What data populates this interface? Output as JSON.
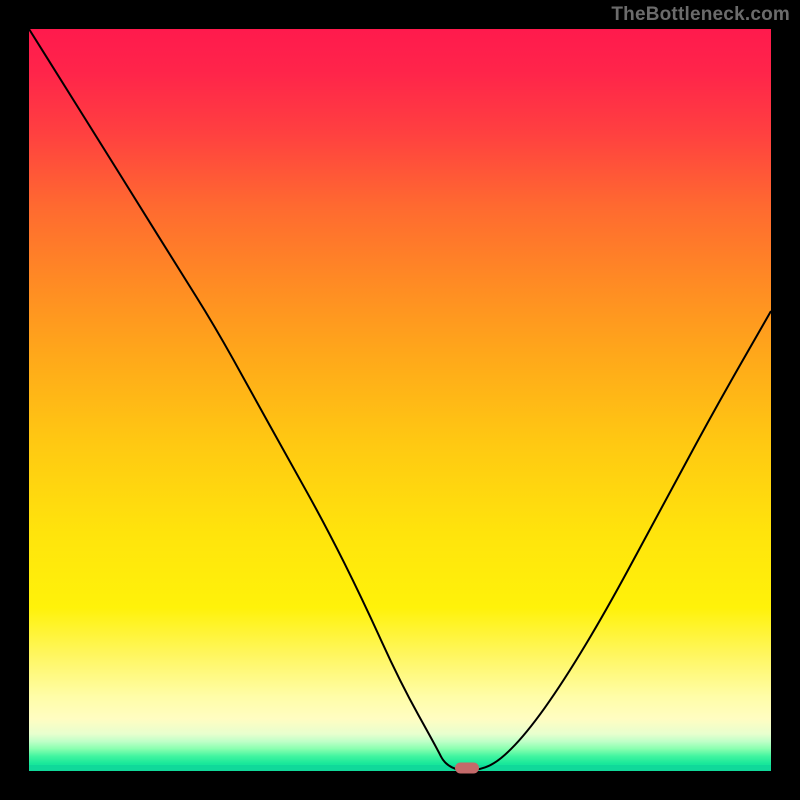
{
  "watermark": "TheBottleneck.com",
  "chart_data": {
    "type": "line",
    "title": "",
    "xlabel": "",
    "ylabel": "",
    "xlim": [
      0,
      100
    ],
    "ylim": [
      0,
      100
    ],
    "grid": false,
    "legend": false,
    "series": [
      {
        "name": "curve",
        "x": [
          0,
          5,
          10,
          15,
          20,
          25,
          30,
          35,
          40,
          45,
          50,
          55,
          56,
          58,
          60,
          63,
          67,
          72,
          78,
          85,
          92,
          100
        ],
        "y": [
          100,
          92,
          84,
          76,
          68,
          60,
          51,
          42,
          33,
          23,
          12,
          3,
          1,
          0,
          0,
          1,
          5,
          12,
          22,
          35,
          48,
          62
        ]
      }
    ],
    "min_marker": {
      "x": 59,
      "y": 0
    },
    "gradient_stops_percent_from_top": {
      "red": 0,
      "orange": 40,
      "yellow": 70,
      "pale_yellow": 92,
      "green": 100
    }
  },
  "colors": {
    "background": "#000000",
    "curve": "#000000",
    "marker": "#c46a6a",
    "watermark": "#6b6b6b",
    "gradient_top": "#ff1a4d",
    "gradient_bottom": "#10d99a"
  }
}
